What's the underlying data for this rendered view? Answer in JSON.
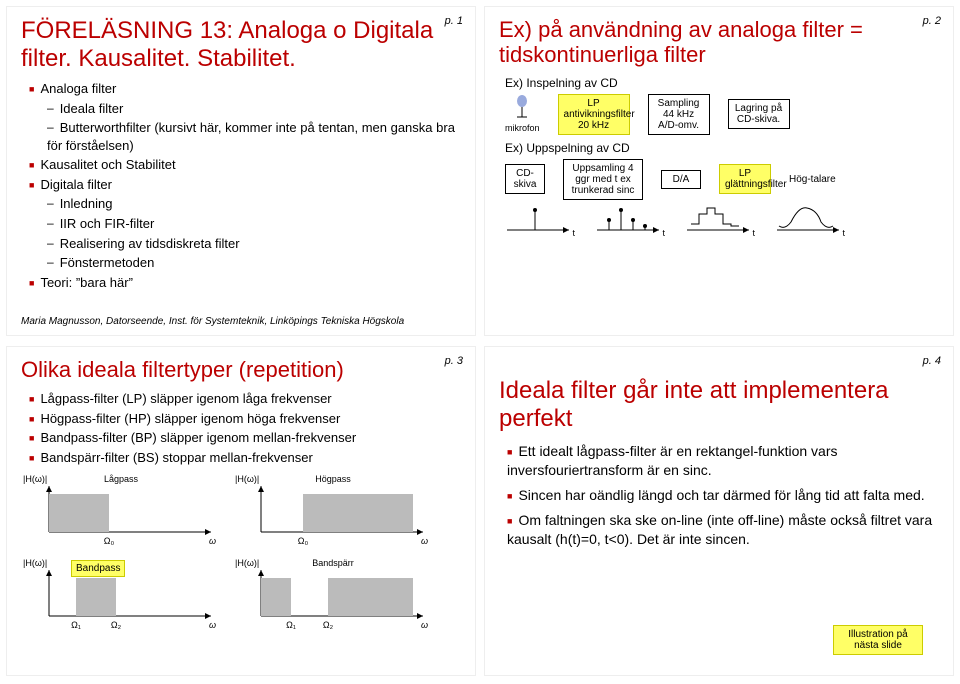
{
  "slides": {
    "s1": {
      "pnum": "p. 1",
      "title": "FÖRELÄSNING 13: Analoga o Digitala filter. Kausalitet. Stabilitet.",
      "b1": "Analoga filter",
      "b1a": "Ideala filter",
      "b1b": "Butterworthfilter (kursivt här, kommer inte på tentan, men ganska bra för förståelsen)",
      "b2": "Kausalitet och Stabilitet",
      "b3": "Digitala filter",
      "b3a": "Inledning",
      "b3b": "IIR och FIR-filter",
      "b3c": "Realisering av tidsdiskreta filter",
      "b3d": "Fönstermetoden",
      "b4": "Teori: ”bara här”",
      "footer": "Maria Magnusson, Datorseende, Inst. för Systemteknik, Linköpings Tekniska Högskola"
    },
    "s2": {
      "pnum": "p. 2",
      "title": "Ex) på användning av analoga filter = tidskontinuerliga filter",
      "row1": "Ex) Inspelning av CD",
      "mic": "mikrofon",
      "lp": "LP antivikningsfilter 20 kHz",
      "samp": "Sampling 44 kHz A/D-omv.",
      "lag": "Lagring på CD-skiva.",
      "row2": "Ex) Uppspelning av CD",
      "cd": "CD-skiva",
      "ups": "Uppsamling 4 ggr med t ex trunkerad sinc",
      "da": "D/A",
      "glatt": "LP glättningsfilter",
      "hogt": "Hög-talare",
      "t": "t"
    },
    "s3": {
      "pnum": "p. 3",
      "title": "Olika ideala filtertyper (repetition)",
      "b1": "Lågpass-filter (LP) släpper igenom låga frekvenser",
      "b2": "Högpass-filter (HP) släpper igenom höga frekvenser",
      "b3": "Bandpass-filter (BP) släpper igenom mellan-frekvenser",
      "b4": "Bandspärr-filter (BS) stoppar mellan-frekvenser",
      "lp": "Lågpass",
      "hp": "Högpass",
      "bp": "Bandpass",
      "bs": "Bandspärr",
      "H": "|H(ω)|",
      "w": "ω",
      "W0": "Ω₀",
      "W1": "Ω₁",
      "W2": "Ω₂"
    },
    "s4": {
      "pnum": "p. 4",
      "title": "Ideala filter går inte att implementera perfekt",
      "b1": "Ett idealt lågpass-filter är en rektangel-funktion vars inversfouriertransform är en sinc.",
      "b2": "Sincen har oändlig längd och tar därmed för lång tid att falta med.",
      "b3": "Om faltningen ska ske on-line (inte off-line) måste också filtret vara kausalt (h(t)=0, t<0). Det är inte sincen.",
      "note": "Illustration på nästa slide"
    }
  },
  "chart_data": [
    {
      "type": "diagram",
      "name": "cd-recording-chain",
      "nodes": [
        "mikrofon",
        "LP antivikningsfilter 20 kHz",
        "Sampling 44 kHz A/D-omv.",
        "Lagring på CD-skiva."
      ]
    },
    {
      "type": "diagram",
      "name": "cd-playback-chain",
      "nodes": [
        "CD-skiva",
        "Uppsamling 4 ggr med t ex trunkerad sinc",
        "D/A",
        "LP glättningsfilter",
        "Högtalare"
      ],
      "impulse_plots": 4
    },
    {
      "type": "bar",
      "name": "ideal-lowpass",
      "title": "Lågpass",
      "xlabel": "ω",
      "ylabel": "|H(ω)|",
      "values": [
        1,
        1,
        1,
        1,
        0,
        0,
        0,
        0
      ],
      "cutoff": "Ω₀"
    },
    {
      "type": "bar",
      "name": "ideal-highpass",
      "title": "Högpass",
      "xlabel": "ω",
      "ylabel": "|H(ω)|",
      "values": [
        0,
        0,
        1,
        1,
        1,
        1,
        1,
        1
      ],
      "cutoff": "Ω₀"
    },
    {
      "type": "bar",
      "name": "ideal-bandpass",
      "title": "Bandpass",
      "xlabel": "ω",
      "ylabel": "|H(ω)|",
      "values": [
        0,
        1,
        1,
        0,
        0,
        0,
        0,
        0
      ],
      "band": [
        "Ω₁",
        "Ω₂"
      ]
    },
    {
      "type": "bar",
      "name": "ideal-bandstop",
      "title": "Bandspärr",
      "xlabel": "ω",
      "ylabel": "|H(ω)|",
      "values": [
        1,
        0,
        0,
        1,
        1,
        1,
        1,
        1
      ],
      "band": [
        "Ω₁",
        "Ω₂"
      ]
    }
  ]
}
